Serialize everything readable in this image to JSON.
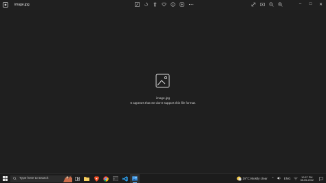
{
  "window": {
    "file_title": "image.jpg",
    "toolbar_center_icons": [
      "edit-image-icon",
      "rotate-icon",
      "delete-icon",
      "favorite-icon",
      "info-icon",
      "more-options-icon",
      "more-icon"
    ],
    "toolbar_right_icons": [
      "fullscreen-icon",
      "slideshow-icon",
      "zoom-out-icon",
      "zoom-in-icon"
    ],
    "controls": {
      "minimize": "–",
      "maximize": "□",
      "close": "✕"
    }
  },
  "viewer": {
    "file_name": "image.jpg",
    "error_message": "It appears that we don't support this file format."
  },
  "taskbar": {
    "search_placeholder": "Type here to search",
    "apps": [
      "task-view-icon",
      "file-explorer-icon",
      "brave-browser-icon",
      "chrome-icon",
      "vscode-icon",
      "terminal-icon",
      "photos-app-icon"
    ],
    "weather": "29°C  Mostly clear",
    "language": "ENG",
    "time": "10:57 PM",
    "date": "08-05-2022"
  },
  "colors": {
    "background": "#1f1f1f",
    "taskbar": "#1c1c1c",
    "accent": "#6fb6f5"
  }
}
